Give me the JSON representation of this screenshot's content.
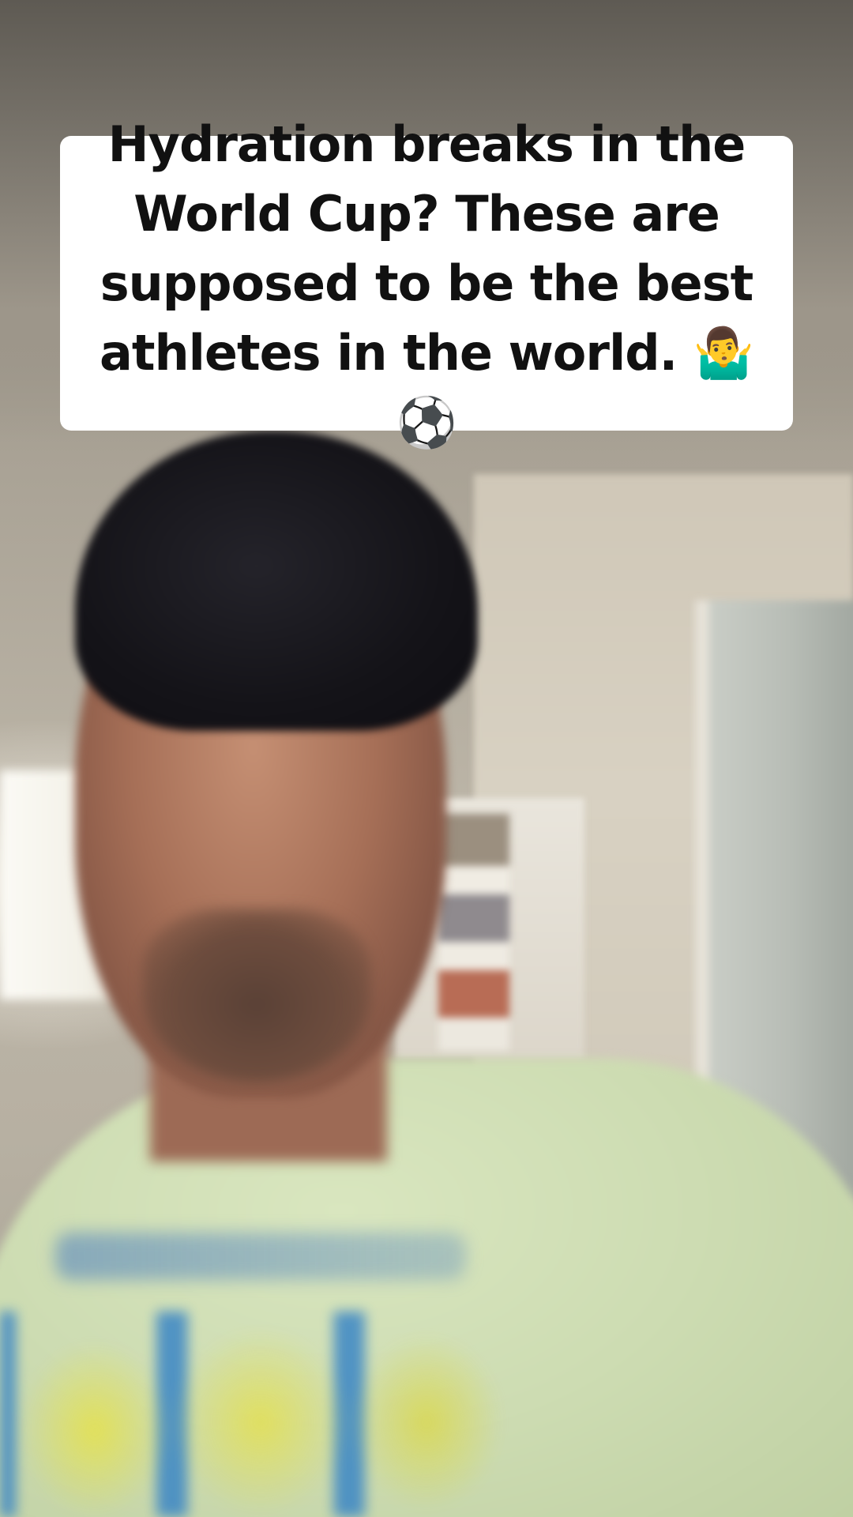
{
  "caption": {
    "text": "Hydration breaks in the\nWorld Cup? These are\nsupposed to be the best\nathletes in the world. 🤷‍♂️⚽"
  }
}
